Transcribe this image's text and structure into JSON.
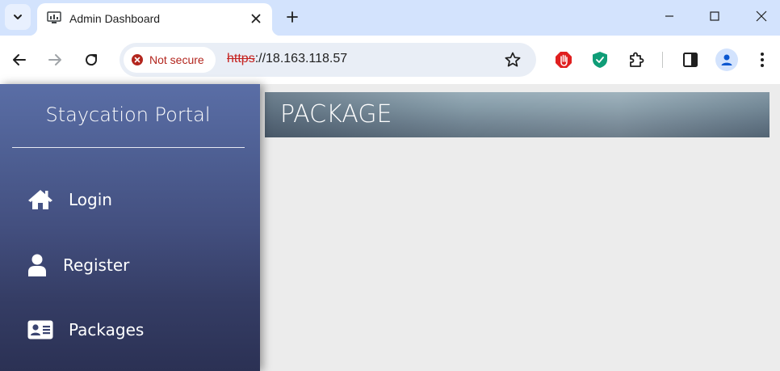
{
  "browser": {
    "tab": {
      "title": "Admin Dashboard"
    },
    "address": {
      "security_label": "Not secure",
      "url_scheme": "https",
      "url_rest": "://18.163.118.57"
    },
    "icons": {
      "tab_search": "chevron-down-icon",
      "tab_close": "close-icon",
      "new_tab": "plus-icon",
      "minimize": "minimize-icon",
      "maximize": "maximize-icon",
      "close_window": "close-icon",
      "back": "arrow-left-icon",
      "forward": "arrow-right-icon",
      "reload": "reload-icon",
      "bookmark": "star-icon",
      "adblock": "stop-hand-icon",
      "shield": "shield-check-icon",
      "extensions": "puzzle-icon",
      "side_panel": "side-panel-icon",
      "profile": "person-icon",
      "menu": "kebab-menu-icon"
    },
    "colors": {
      "tabstrip": "#d3e3fd",
      "not_secure": "#b3261e"
    }
  },
  "sidebar": {
    "brand": "Staycation Portal",
    "items": [
      {
        "label": "Login",
        "icon": "home-icon"
      },
      {
        "label": "Register",
        "icon": "user-icon"
      },
      {
        "label": "Packages",
        "icon": "id-card-icon"
      }
    ]
  },
  "main": {
    "title": "PACKAGE"
  }
}
